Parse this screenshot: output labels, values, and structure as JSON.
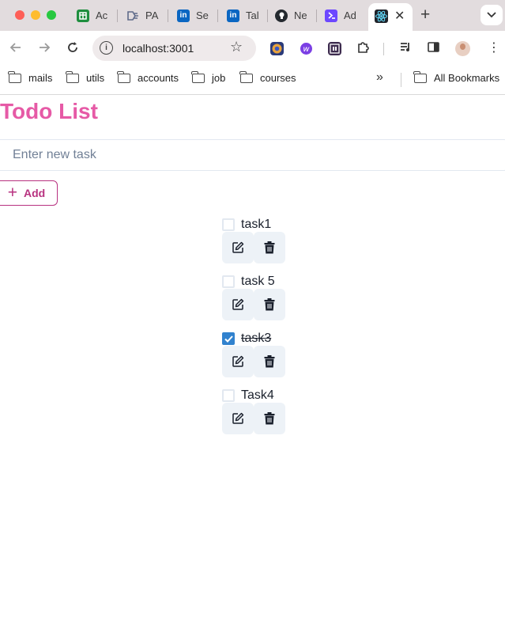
{
  "browser": {
    "tabs": [
      {
        "title": "Ac",
        "icon": "google-sheets-icon",
        "color": "#1e8e3e"
      },
      {
        "title": "PA",
        "icon": "pa-icon",
        "color": "#5f6b8a"
      },
      {
        "title": "Se",
        "icon": "linkedin-icon",
        "color": "#0a66c2"
      },
      {
        "title": "Tal",
        "icon": "linkedin-icon",
        "color": "#0a66c2"
      },
      {
        "title": "Ne",
        "icon": "github-icon",
        "color": "#24292f"
      },
      {
        "title": "Ad",
        "icon": "terminal-icon",
        "color": "#6c47ff"
      }
    ],
    "active_tab_icon": "react-icon",
    "url": "localhost:3001",
    "bookmarks": [
      "mails",
      "utils",
      "accounts",
      "job",
      "courses"
    ],
    "all_bookmarks_label": "All Bookmarks"
  },
  "app": {
    "title": "Todo List",
    "input_placeholder": "Enter new task",
    "add_label": "Add",
    "title_color": "#e65aa6",
    "accent_color": "#b83280",
    "tasks": [
      {
        "label": "task1",
        "done": false
      },
      {
        "label": "task 5",
        "done": false
      },
      {
        "label": "task3",
        "done": true
      },
      {
        "label": "Task4",
        "done": false
      }
    ]
  }
}
